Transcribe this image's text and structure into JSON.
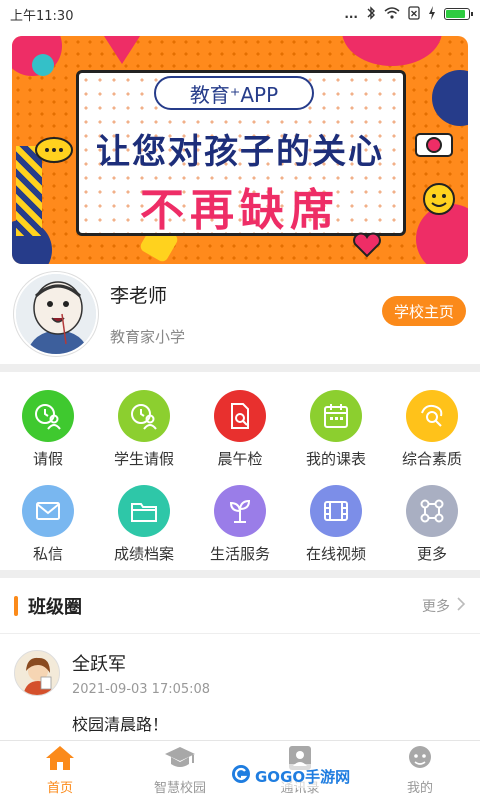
{
  "status_bar": {
    "time": "上午11:30",
    "dots": "...",
    "battery_level": 0.8
  },
  "banner": {
    "pill_text": "教育⁺APP",
    "line1": "让您对孩子的关心",
    "line2": "不再缺席"
  },
  "teacher": {
    "name": "李老师",
    "school": "教育家小学",
    "school_home_button": "学校主页"
  },
  "grid": {
    "items": [
      {
        "label": "请假",
        "icon": "leave-clock-user-icon",
        "color": "#3fc92f"
      },
      {
        "label": "学生请假",
        "icon": "student-leave-icon",
        "color": "#8ccf2f"
      },
      {
        "label": "晨午检",
        "icon": "health-check-doc-icon",
        "color": "#e8302e"
      },
      {
        "label": "我的课表",
        "icon": "calendar-icon",
        "color": "#8ccf2f"
      },
      {
        "label": "综合素质",
        "icon": "quality-badge-icon",
        "color": "#ffc21a"
      },
      {
        "label": "私信",
        "icon": "mail-icon",
        "color": "#79b7f0"
      },
      {
        "label": "成绩档案",
        "icon": "folder-icon",
        "color": "#2ec7a8"
      },
      {
        "label": "生活服务",
        "icon": "plant-icon",
        "color": "#9a7de8"
      },
      {
        "label": "在线视频",
        "icon": "film-icon",
        "color": "#7c8ee8"
      },
      {
        "label": "更多",
        "icon": "more-nodes-icon",
        "color": "#a9afc2"
      }
    ]
  },
  "class_circle": {
    "title": "班级圈",
    "more": "更多",
    "post": {
      "author": "全跃军",
      "time": "2021-09-03 17:05:08",
      "text": "校园清晨路！"
    }
  },
  "tabbar": {
    "tabs": [
      {
        "label": "首页",
        "icon": "home-icon",
        "active": true
      },
      {
        "label": "智慧校园",
        "icon": "graduation-cap-icon",
        "active": false
      },
      {
        "label": "通讯录",
        "icon": "contacts-icon",
        "active": false
      },
      {
        "label": "我的",
        "icon": "profile-icon",
        "active": false
      }
    ]
  },
  "watermark": {
    "text": "GOGO手游网"
  },
  "colors": {
    "accent": "#fb8a1a",
    "divider": "#eeeeee"
  }
}
